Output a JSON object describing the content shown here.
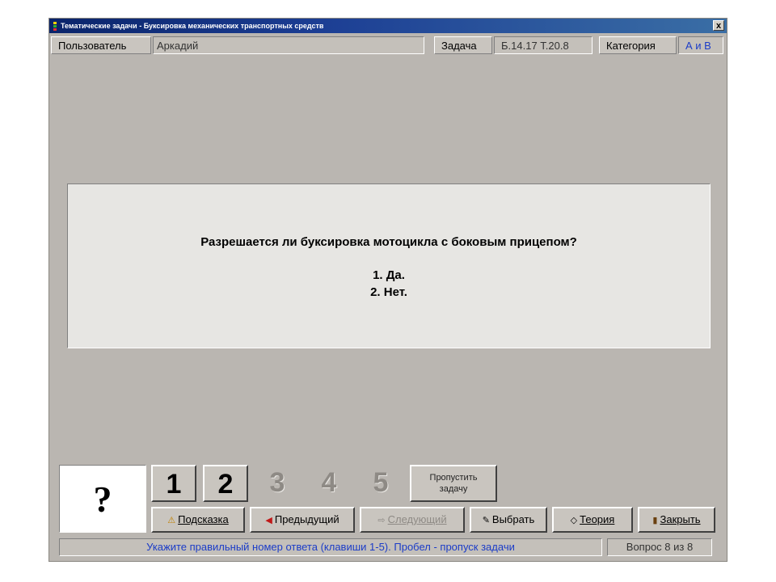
{
  "window": {
    "title": "Тематические задачи - Буксировка механических транспортных средств",
    "close_label": "x"
  },
  "infobar": {
    "user_label": "Пользователь",
    "user_value": "Аркадий",
    "task_label": "Задача",
    "task_value": "Б.14.17  Т.20.8",
    "category_label": "Категория",
    "category_value": "А и В"
  },
  "question": {
    "text": "Разрешается ли буксировка мотоцикла с боковым прицепом?",
    "answers": [
      "1. Да.",
      "2. Нет."
    ]
  },
  "answer_panel": {
    "placeholder": "?",
    "numbers": [
      "1",
      "2",
      "3",
      "4",
      "5"
    ],
    "skip_label": "Пропустить задачу"
  },
  "buttons": {
    "hint": "Подсказка",
    "prev": "Предыдущий",
    "next": "Следующий",
    "select": "Выбрать",
    "theory": "Теория",
    "close": "Закрыть"
  },
  "status": {
    "instruction": "Укажите правильный номер ответа (клавиши 1-5). Пробел - пропуск задачи",
    "progress": "Вопрос 8 из 8"
  },
  "colors": {
    "window_bg": "#bab6b1",
    "titlebar": "#0a246a",
    "status_text": "#1b3cc8",
    "category_accent": "#1b3cc8",
    "arrow_red": "#c01818"
  }
}
